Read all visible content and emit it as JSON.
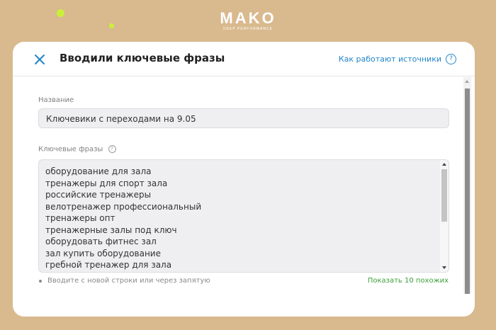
{
  "brand": {
    "name": "MAKO",
    "tagline": "DEEP PERFORMANCE"
  },
  "modal": {
    "title": "Вводили ключевые фразы",
    "help_link": "Как работают источники",
    "help_icon_glyph": "?",
    "close_icon": "close-icon",
    "name_label": "Название",
    "name_value": "Ключевики с переходами на 9.05",
    "phrases_label": "Ключевые фразы",
    "phrases_info_glyph": "?",
    "phrases": [
      "оборудование для зала",
      "тренажеры для спорт зала",
      "российские тренажеры",
      "велотренажер профессиональный",
      "тренажеры опт",
      "тренажерные залы под ключ",
      "оборудовать фитнес зал",
      "зал купить оборудование",
      "гребной тренажер для зала"
    ],
    "hint": "Вводите с новой строки или через запятую",
    "similar_link": "Показать 10 похожих"
  },
  "colors": {
    "accent": "#1f84c9",
    "success": "#3fa03c",
    "background": "#d9b98e",
    "lime": "#c8f03a"
  }
}
